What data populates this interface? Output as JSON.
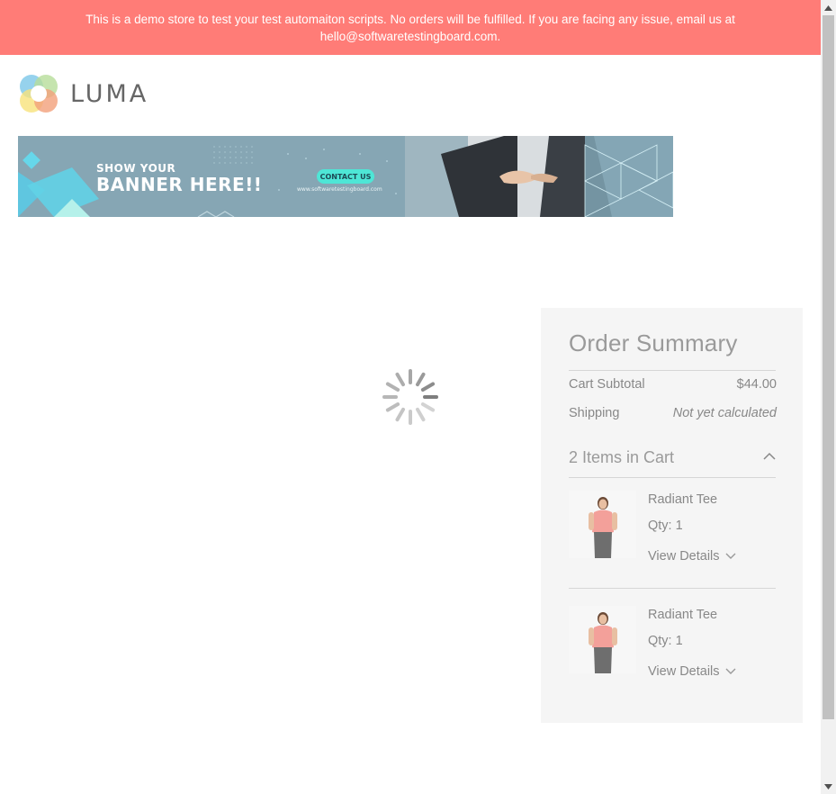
{
  "notice": {
    "text": "This is a demo store to test your test automaiton scripts. No orders will be fulfilled. If you are facing any issue, email us at hello@softwaretestingboard.com."
  },
  "header": {
    "logo_text": "LUMA"
  },
  "banner": {
    "line1": "SHOW YOUR",
    "line2": "BANNER HERE!!",
    "cta": "CONTACT US",
    "url": "www.softwaretestingboard.com"
  },
  "loader": {
    "icon": "loading-spinner-icon"
  },
  "summary": {
    "title": "Order Summary",
    "subtotal_label": "Cart Subtotal",
    "subtotal_value": "$44.00",
    "shipping_label": "Shipping",
    "shipping_value": "Not yet calculated",
    "items_title": "2 Items in Cart",
    "items": [
      {
        "name": "Radiant Tee",
        "qty": "Qty: 1",
        "details": "View Details"
      },
      {
        "name": "Radiant Tee",
        "qty": "Qty: 1",
        "details": "View Details"
      }
    ]
  },
  "colors": {
    "notice_bg": "#ff7c77",
    "summary_bg": "#f5f5f5",
    "text_muted": "#888888"
  }
}
